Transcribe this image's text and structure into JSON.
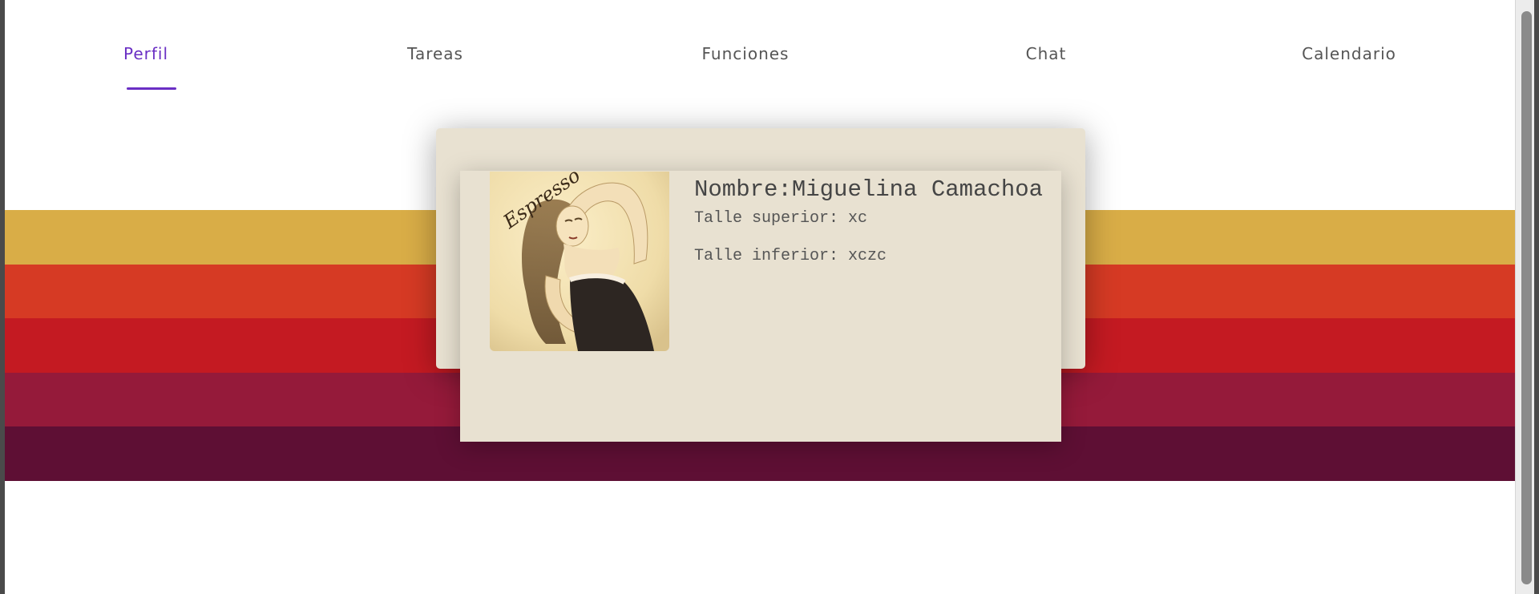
{
  "tabs": [
    {
      "label": "Perfil",
      "active": true
    },
    {
      "label": "Tareas",
      "active": false
    },
    {
      "label": "Funciones",
      "active": false
    },
    {
      "label": "Chat",
      "active": false
    },
    {
      "label": "Calendario",
      "active": false
    }
  ],
  "colors": {
    "accent": "#6a2fc4",
    "card_background": "#e8e1d1",
    "stripes": [
      "#d9ad47",
      "#d63a24",
      "#c41a22",
      "#951a3a",
      "#5e0f34"
    ]
  },
  "profile": {
    "name_label": "Nombre:",
    "name_value": "Miguelina Camachoa",
    "photo_caption": "Espresso",
    "top_size_label": "Talle superior:",
    "top_size_value": "xc",
    "bottom_size_label": "Talle inferior:",
    "bottom_size_value": "xczc"
  }
}
